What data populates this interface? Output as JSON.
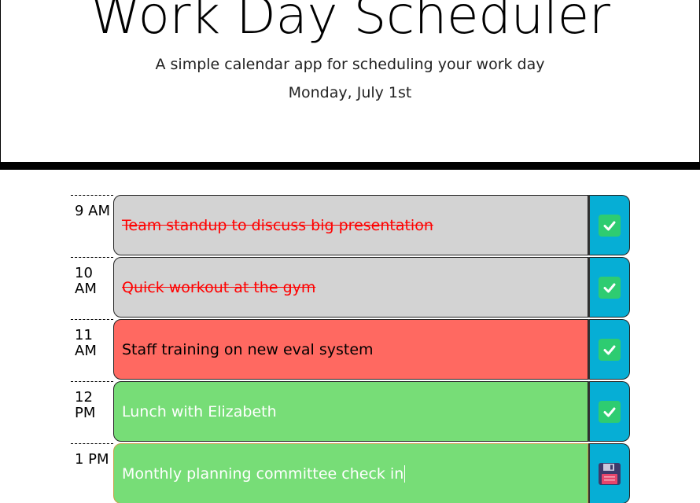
{
  "header": {
    "title": "Work Day Scheduler",
    "subtitle": "A simple calendar app for scheduling your work day",
    "current_day": "Monday, July 1st"
  },
  "colors": {
    "past": "#d3d3d3",
    "present": "#ff6961",
    "future": "#77dd77",
    "save_button": "#06aed5",
    "past_text": "#ff0000"
  },
  "timeblocks": [
    {
      "hour": "9 AM",
      "text": "Team standup to discuss big presentation",
      "state": "past",
      "button_icon": "check-icon"
    },
    {
      "hour": "10\nAM",
      "text": "Quick workout at the gym",
      "state": "past",
      "button_icon": "check-icon"
    },
    {
      "hour": "11\nAM",
      "text": "Staff training on new eval system",
      "state": "present",
      "button_icon": "check-icon"
    },
    {
      "hour": "12\nPM",
      "text": "Lunch with Elizabeth",
      "state": "future",
      "button_icon": "check-icon"
    },
    {
      "hour": "1 PM",
      "text": "Monthly planning committee check in",
      "state": "future",
      "button_icon": "floppy-disk-icon"
    }
  ]
}
